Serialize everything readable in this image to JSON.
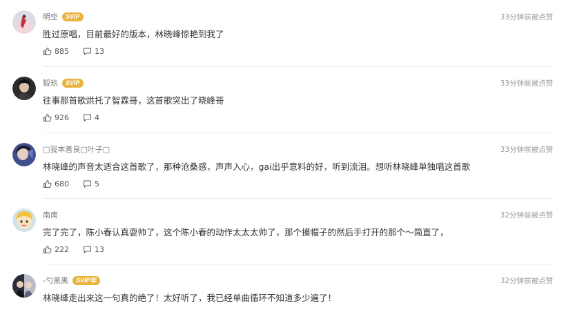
{
  "comments": [
    {
      "name": "明空",
      "badge": "SVIP",
      "time": "33分钟前被点赞",
      "text": "胜过原唱，目前最好的版本，林晓峰惊艳到我了",
      "likes": "885",
      "replies": "13"
    },
    {
      "name": "毅玖",
      "badge": "SVIP",
      "time": "33分钟前被点赞",
      "text": "往事那首歌烘托了智霖哥，这首歌突出了晓峰哥",
      "likes": "926",
      "replies": "4"
    },
    {
      "name": "□我本善良□叶子□",
      "badge": "",
      "time": "33分钟前被点赞",
      "text": "林晓峰的声音太适合这首歌了，那种沧桑感，声声入心，gai出乎意料的好，听到流泪。想听林晓峰单独唱这首歌",
      "likes": "680",
      "replies": "5"
    },
    {
      "name": "南南",
      "badge": "",
      "time": "32分钟前被点赞",
      "text": "完了完了，陈小春认真耍帅了，这个陈小春的动作太太太帅了，那个摸帽子的然后手打开的那个～简直了，",
      "likes": "222",
      "replies": "13"
    },
    {
      "name": "-勺黑黑",
      "badge": "SVIP年",
      "time": "32分钟前被点赞",
      "text": "林晓峰走出来这一句真的绝了！太好听了，我已经单曲循环不知道多少遍了！",
      "likes": "",
      "replies": ""
    }
  ],
  "colors": {
    "badge": "#e8b43f",
    "text": "#333333",
    "meta": "#999999"
  },
  "icons": {
    "like": "thumbs-up-icon",
    "reply": "comment-bubble-icon"
  }
}
